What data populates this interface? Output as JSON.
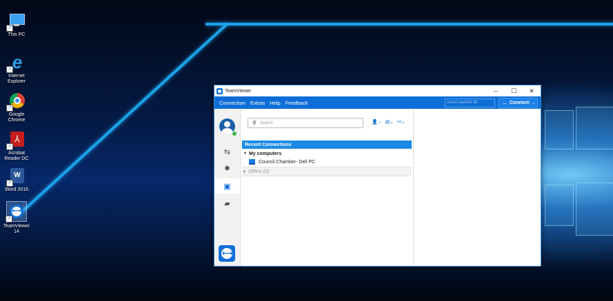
{
  "desktop": {
    "icons": [
      {
        "label": "This PC",
        "icon": "computer-icon"
      },
      {
        "label": "Internet Explorer",
        "icon": "internet-explorer-icon"
      },
      {
        "label": "Google Chrome",
        "icon": "chrome-icon"
      },
      {
        "label": "Acrobat Reader DC",
        "icon": "acrobat-icon"
      },
      {
        "label": "Word 2016",
        "icon": "word-icon"
      },
      {
        "label": "TeamViewer 14",
        "icon": "teamviewer-icon"
      }
    ]
  },
  "window": {
    "title": "TeamViewer",
    "controls": {
      "minimize": "–",
      "maximize": "☐",
      "close": "✕"
    },
    "menu": [
      "Connection",
      "Extras",
      "Help",
      "Feedback"
    ],
    "partner_placeholder": "Insert partner ID",
    "connect_label": "Connect",
    "search_placeholder": "Search",
    "list": {
      "recent": "Recent Connections",
      "my_computers": "My computers",
      "computer": "Council Chamber- Dell PC",
      "offline": "Offline (0)"
    }
  },
  "colors": {
    "accent": "#0e6ed8",
    "selected": "#1a8ae6",
    "online": "#3bb54a"
  }
}
